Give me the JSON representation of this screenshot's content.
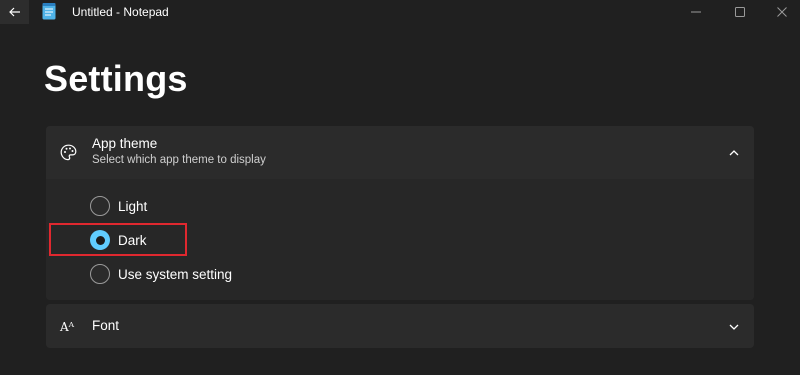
{
  "window": {
    "title": "Untitled - Notepad"
  },
  "page": {
    "title": "Settings"
  },
  "app_theme": {
    "title": "App theme",
    "subtitle": "Select which app theme to display",
    "expanded": true,
    "options": [
      {
        "label": "Light",
        "selected": false
      },
      {
        "label": "Dark",
        "selected": true
      },
      {
        "label": "Use system setting",
        "selected": false
      }
    ]
  },
  "font_section": {
    "title": "Font",
    "icon_glyph": "Aᴬ",
    "expanded": false
  },
  "colors": {
    "background": "#202020",
    "accent": "#60cdff",
    "highlight": "#e0282f"
  },
  "icons": {
    "back": "back-arrow-icon",
    "app": "notepad-icon",
    "theme": "palette-icon",
    "font": "font-icon"
  }
}
